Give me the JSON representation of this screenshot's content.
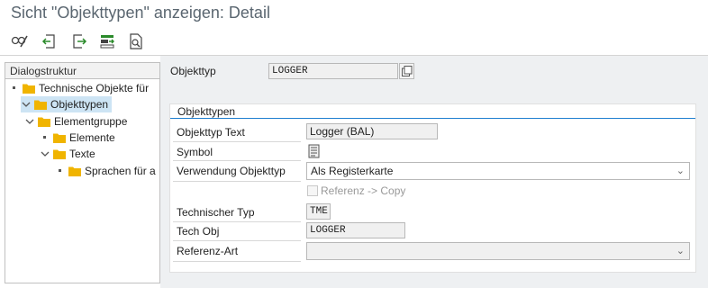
{
  "window": {
    "title": "Sicht \"Objekttypen\" anzeigen: Detail"
  },
  "toolbar": {
    "buttons": [
      {
        "icon": "display-change-icon"
      },
      {
        "icon": "previous-entry-icon"
      },
      {
        "icon": "next-entry-icon"
      },
      {
        "icon": "select-block-icon"
      },
      {
        "icon": "other-entry-icon"
      }
    ]
  },
  "dialog_structure": {
    "header": "Dialogstruktur",
    "items": [
      {
        "label": "Technische Objekte für",
        "level": 0,
        "expander": "leaf",
        "selected": false
      },
      {
        "label": "Objekttypen",
        "level": 0,
        "expander": "open",
        "selected": true
      },
      {
        "label": "Elementgruppe",
        "level": 1,
        "expander": "open",
        "selected": false
      },
      {
        "label": "Elemente",
        "level": 2,
        "expander": "leaf",
        "selected": false
      },
      {
        "label": "Texte",
        "level": 2,
        "expander": "open",
        "selected": false
      },
      {
        "label": "Sprachen für a",
        "level": 3,
        "expander": "leaf",
        "selected": false
      }
    ]
  },
  "header_field": {
    "label": "Objekttyp",
    "value": "LOGGER"
  },
  "group": {
    "title": "Objekttypen",
    "objekttyp_text": {
      "label": "Objekttyp Text",
      "value": "Logger (BAL)"
    },
    "symbol": {
      "label": "Symbol",
      "icon": "document-icon"
    },
    "verwendung": {
      "label": "Verwendung Objekttyp",
      "value": "Als Registerkarte"
    },
    "referenz_copy": {
      "label": "Referenz -> Copy",
      "checked": false
    },
    "technischer_typ": {
      "label": "Technischer Typ",
      "value": "TME"
    },
    "tech_obj": {
      "label": "Tech Obj",
      "value": "LOGGER"
    },
    "referenz_art": {
      "label": "Referenz-Art",
      "value": ""
    }
  },
  "colors": {
    "accent": "#1f7fd0",
    "folder": "#f0b400",
    "selection": "#cde4f4",
    "background": "#eef0f2"
  }
}
